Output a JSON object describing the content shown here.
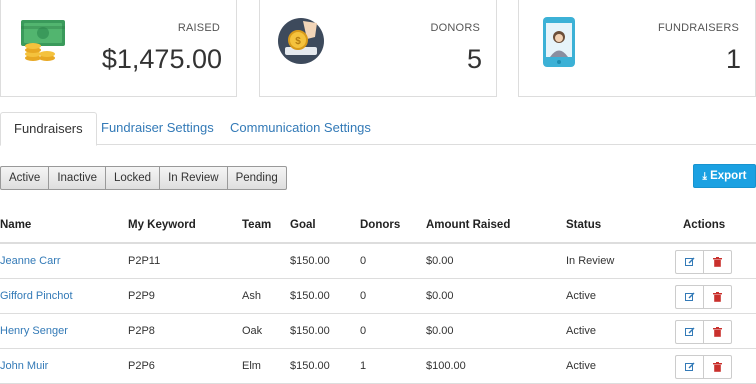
{
  "stats": {
    "raised": {
      "label": "RAISED",
      "value": "$1,475.00",
      "icon": "money-stack-icon"
    },
    "donors": {
      "label": "DONORS",
      "value": "5",
      "icon": "coin-donation-icon"
    },
    "fundraisers": {
      "label": "FUNDRAISERS",
      "value": "1",
      "icon": "phone-person-icon"
    }
  },
  "tabs": [
    {
      "label": "Fundraisers",
      "active": true
    },
    {
      "label": "Fundraiser Settings",
      "active": false
    },
    {
      "label": "Communication Settings",
      "active": false
    }
  ],
  "filters": [
    "Active",
    "Inactive",
    "Locked",
    "In Review",
    "Pending"
  ],
  "export_label": "Export",
  "table": {
    "headers": {
      "name": "Name",
      "keyword": "My Keyword",
      "team": "Team",
      "goal": "Goal",
      "donors": "Donors",
      "amount": "Amount Raised",
      "status": "Status",
      "actions": "Actions"
    },
    "rows": [
      {
        "name": "Jeanne Carr",
        "keyword": "P2P11",
        "team": "",
        "goal": "$150.00",
        "donors": "0",
        "amount": "$0.00",
        "status": "In Review"
      },
      {
        "name": "Gifford Pinchot",
        "keyword": "P2P9",
        "team": "Ash",
        "goal": "$150.00",
        "donors": "0",
        "amount": "$0.00",
        "status": "Active"
      },
      {
        "name": "Henry Senger",
        "keyword": "P2P8",
        "team": "Oak",
        "goal": "$150.00",
        "donors": "0",
        "amount": "$0.00",
        "status": "Active"
      },
      {
        "name": "John Muir",
        "keyword": "P2P6",
        "team": "Elm",
        "goal": "$150.00",
        "donors": "1",
        "amount": "$100.00",
        "status": "Active"
      }
    ]
  },
  "colors": {
    "link": "#337ab7",
    "export_bg": "#1ba1e2",
    "delete_icon": "#c9302c"
  }
}
